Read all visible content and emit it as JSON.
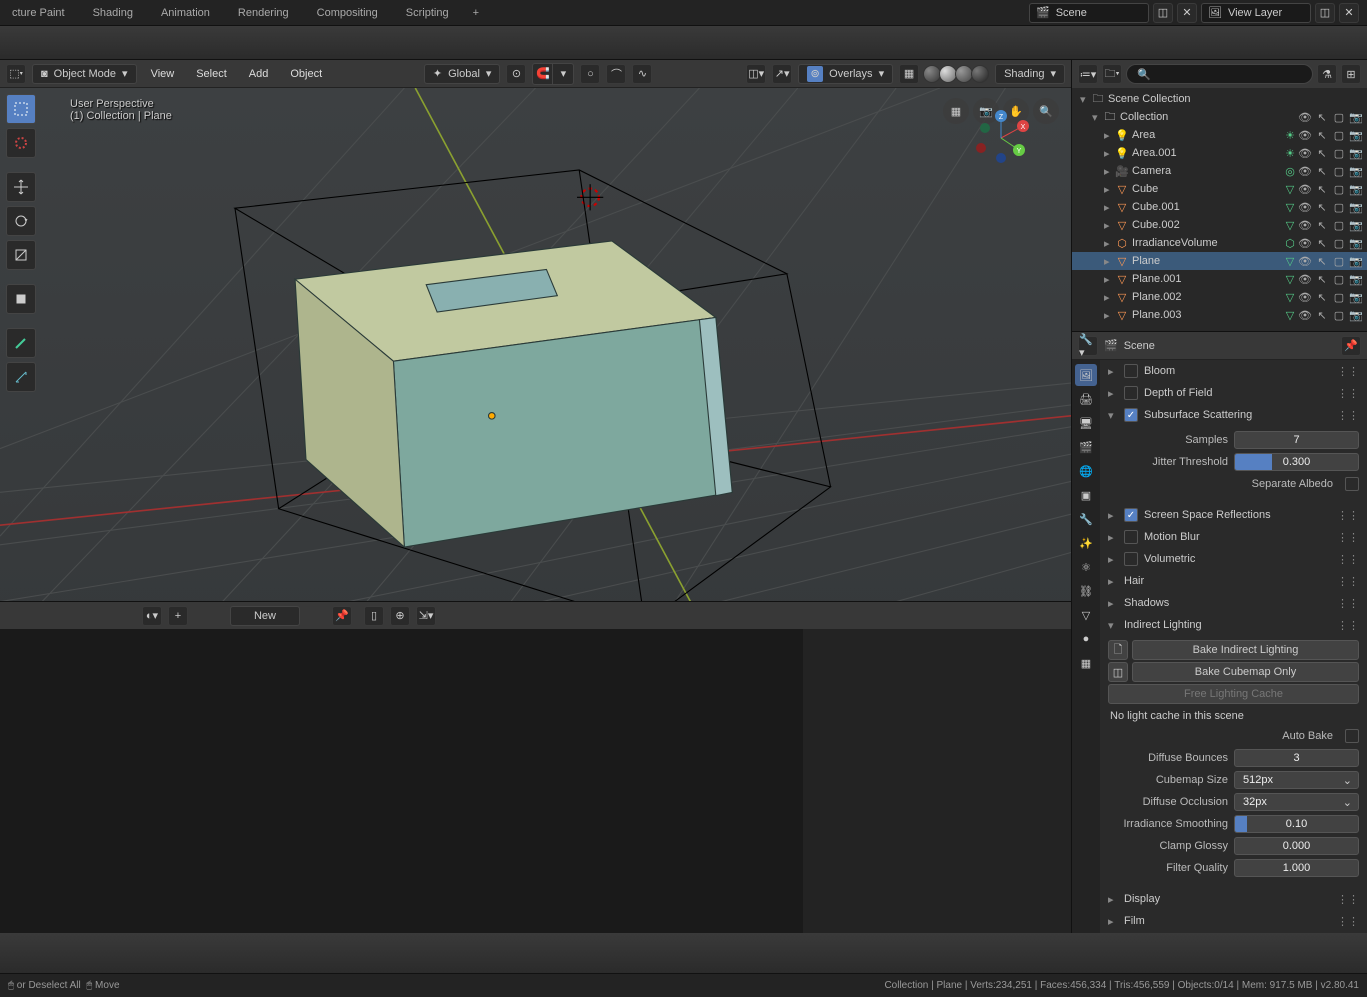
{
  "top_menu": {
    "items": [
      "cture Paint",
      "Shading",
      "Animation",
      "Rendering",
      "Compositing",
      "Scripting"
    ],
    "scene_label": "Scene",
    "layer_label": "View Layer"
  },
  "viewport": {
    "mode": "Object Mode",
    "menus": [
      "View",
      "Select",
      "Add",
      "Object"
    ],
    "orientation": "Global",
    "overlays": "Overlays",
    "shading": "Shading",
    "label_line1": "User Perspective",
    "label_line2": "(1) Collection | Plane"
  },
  "timeline": {
    "new_label": "New"
  },
  "outliner": {
    "root": "Scene Collection",
    "collection": "Collection",
    "items": [
      {
        "name": "Area",
        "icon": "light",
        "color": "#ffbb66"
      },
      {
        "name": "Area.001",
        "icon": "light",
        "color": "#ffbb66"
      },
      {
        "name": "Camera",
        "icon": "camera",
        "color": "#ffaa77"
      },
      {
        "name": "Cube",
        "icon": "mesh",
        "color": "#ff9955"
      },
      {
        "name": "Cube.001",
        "icon": "mesh",
        "color": "#ff9955"
      },
      {
        "name": "Cube.002",
        "icon": "mesh",
        "color": "#ff9955"
      },
      {
        "name": "IrradianceVolume",
        "icon": "probe",
        "color": "#ff9955"
      },
      {
        "name": "Plane",
        "icon": "mesh",
        "color": "#ff9955",
        "selected": true
      },
      {
        "name": "Plane.001",
        "icon": "mesh",
        "color": "#ff9955"
      },
      {
        "name": "Plane.002",
        "icon": "mesh",
        "color": "#ff9955"
      },
      {
        "name": "Plane.003",
        "icon": "mesh",
        "color": "#ff9955"
      }
    ]
  },
  "properties": {
    "context": "Scene",
    "panels": {
      "bloom": {
        "label": "Bloom",
        "checked": false
      },
      "dof": {
        "label": "Depth of Field",
        "checked": false
      },
      "sss": {
        "label": "Subsurface Scattering",
        "checked": true,
        "expanded": true,
        "samples_label": "Samples",
        "samples": "7",
        "jitter_label": "Jitter Threshold",
        "jitter": "0.300",
        "jitter_fill": 30,
        "sep_albedo_label": "Separate Albedo"
      },
      "ssr": {
        "label": "Screen Space Reflections",
        "checked": true
      },
      "mblur": {
        "label": "Motion Blur",
        "checked": false
      },
      "vol": {
        "label": "Volumetric",
        "checked": false
      },
      "hair": {
        "label": "Hair"
      },
      "shadows": {
        "label": "Shadows"
      },
      "indirect": {
        "label": "Indirect Lighting",
        "expanded": true,
        "bake_indirect": "Bake Indirect Lighting",
        "bake_cubemap": "Bake Cubemap Only",
        "free_cache": "Free Lighting Cache",
        "no_cache": "No light cache in this scene",
        "auto_bake_label": "Auto Bake",
        "diffuse_bounces_l": "Diffuse Bounces",
        "diffuse_bounces": "3",
        "cubemap_size_l": "Cubemap Size",
        "cubemap_size": "512px",
        "diffuse_occ_l": "Diffuse Occlusion",
        "diffuse_occ": "32px",
        "irr_smooth_l": "Irradiance Smoothing",
        "irr_smooth": "0.10",
        "irr_fill": 10,
        "clamp_glossy_l": "Clamp Glossy",
        "clamp_glossy": "0.000",
        "filter_quality_l": "Filter Quality",
        "filter_quality": "1.000"
      },
      "display": {
        "label": "Display"
      },
      "film": {
        "label": "Film"
      }
    }
  },
  "status": {
    "left1": "or Deselect All",
    "left2": "Move",
    "right": "Collection | Plane | Verts:234,251 | Faces:456,334 | Tris:456,559 | Objects:0/14 | Mem: 917.5 MB | v2.80.41"
  }
}
